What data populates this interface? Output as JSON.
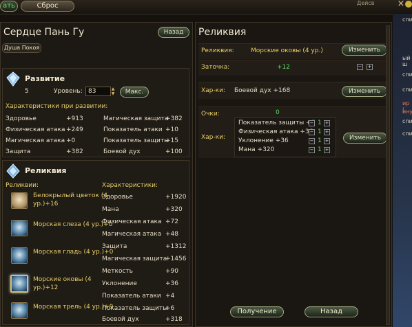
{
  "topbar": {
    "left_button": "ать",
    "reset_button": "Сброс",
    "right_text": "Дейсв",
    "close_symbol": "×"
  },
  "left": {
    "title": "Сердце Пань Гу",
    "back_button": "Назад",
    "tag": "Душа Покоя",
    "development": {
      "title": "Развитие",
      "level_value": "5",
      "level_label": "Уровень:",
      "level_input": "83",
      "max_button": "Макс.",
      "stats_header": "Характеристики при развитии:",
      "stats": [
        {
          "name": "Здоровье",
          "value": "+913"
        },
        {
          "name": "Магическая защита",
          "value": "+382"
        },
        {
          "name": "Физическая атака",
          "value": "+249"
        },
        {
          "name": "Показатель атаки",
          "value": "+10"
        },
        {
          "name": "Магическая атака",
          "value": "+0"
        },
        {
          "name": "Показатель защиты",
          "value": "+15"
        },
        {
          "name": "Защита",
          "value": "+382"
        },
        {
          "name": "Боевой дух",
          "value": "+100"
        }
      ]
    },
    "relics": {
      "title": "Реликвия",
      "list_header": "Реликвии:",
      "chars_header": "Характеристики:",
      "items": [
        {
          "line1": "Белокрылый цветок (4",
          "line2": "ур.)+16"
        },
        {
          "line1": "Морская слеза (4 ур.)+0",
          "line2": ""
        },
        {
          "line1": "Морская гладь (4 ур.)+0",
          "line2": ""
        },
        {
          "line1": "Морские оковы (4",
          "line2": "ур.)+12"
        },
        {
          "line1": "Морская трель (4 ур.)+9",
          "line2": ""
        }
      ],
      "chars": [
        {
          "name": "Здоровье",
          "value": "+1920"
        },
        {
          "name": "Мана",
          "value": "+320"
        },
        {
          "name": "Физическая атака",
          "value": "+72"
        },
        {
          "name": "Магическая атака",
          "value": "+48"
        },
        {
          "name": "Защита",
          "value": "+1312"
        },
        {
          "name": "Магическая защита",
          "value": "+1456"
        },
        {
          "name": "Меткость",
          "value": "+90"
        },
        {
          "name": "Уклонение",
          "value": "+36"
        },
        {
          "name": "Показатель атаки",
          "value": "+4"
        },
        {
          "name": "Показатель защиты",
          "value": "+6"
        },
        {
          "name": "Боевой дух",
          "value": "+318"
        }
      ]
    }
  },
  "right": {
    "title": "Реликвия",
    "relic_label": "Реликвия:",
    "relic_name": "Морские оковы (4 ур.)",
    "change_button": "Изменить",
    "sharpen_label": "Заточка:",
    "sharpen_value": "+12",
    "chars_label": "Хар-ки:",
    "chars_value": "Боевой дух +168",
    "points_label": "Очки:",
    "points_value": "0",
    "chars2_label": "Хар-ки:",
    "bonus_stats": [
      {
        "name": "Показатель защиты +6",
        "value": "1"
      },
      {
        "name": "Физическая атака +36",
        "value": "1"
      },
      {
        "name": "Уклонение +36",
        "value": "1"
      },
      {
        "name": "Мана +320",
        "value": "1"
      }
    ],
    "get_button": "Получение",
    "back_button": "Назад"
  },
  "bg_chat": [
    "спи",
    "ый ш",
    "спи",
    "спи",
    "ир (",
    "инут",
    "спи",
    "спи"
  ]
}
